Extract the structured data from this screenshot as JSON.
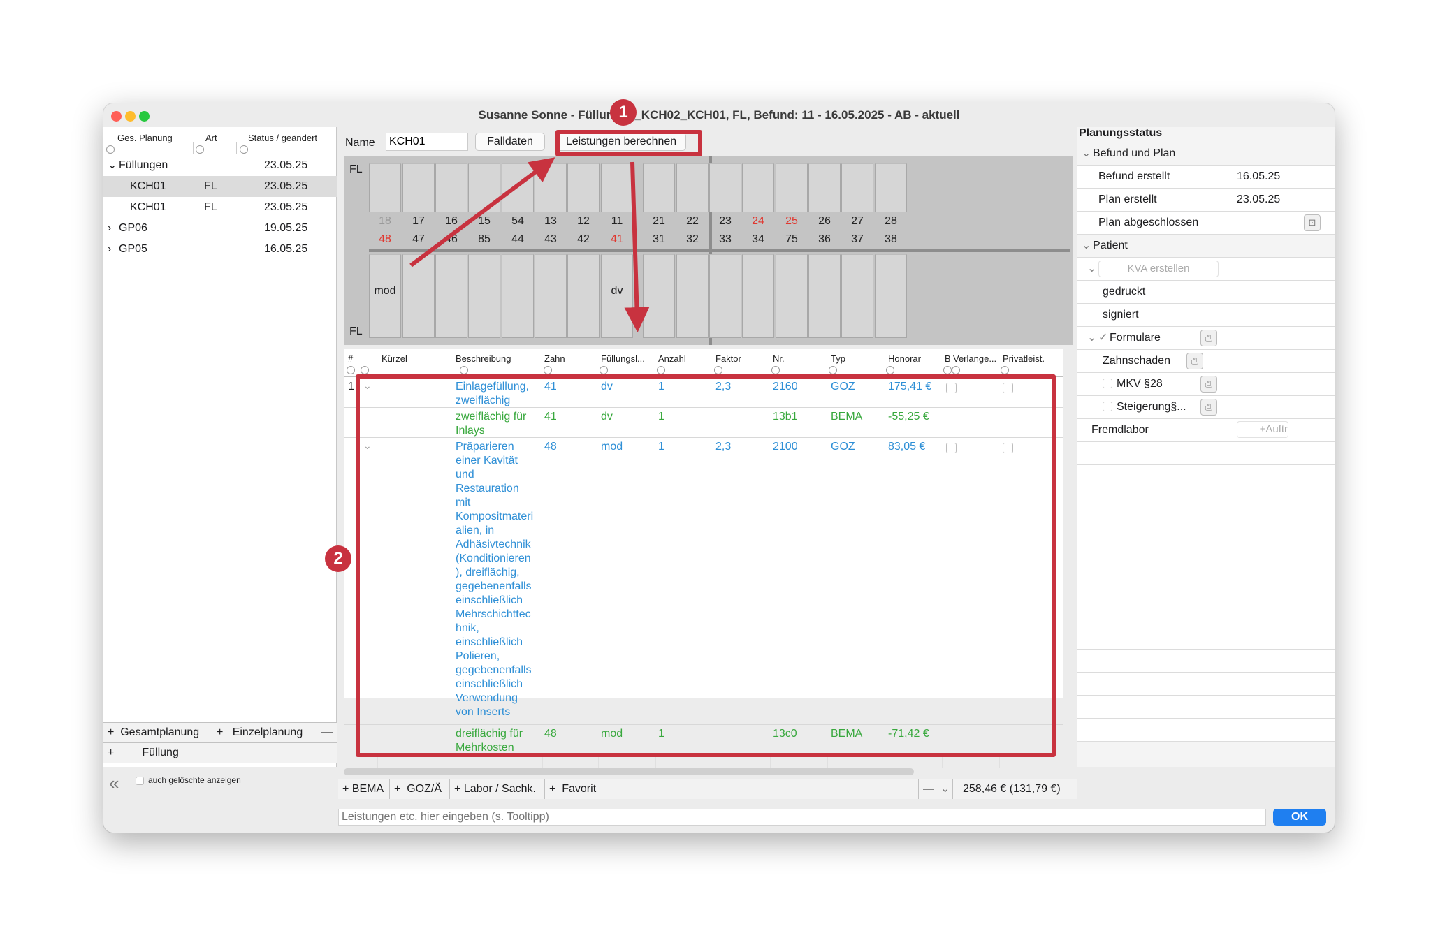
{
  "window": {
    "title": "Susanne Sonne  -  Füllungen_KCH02_KCH01, FL, Befund: 11 - 16.05.2025 - AB - aktuell"
  },
  "left_panel": {
    "headers": [
      "Ges. Planung",
      "Art",
      "Status / geändert"
    ],
    "rows": [
      {
        "name": "Füllungen",
        "art": "",
        "date": "23.05.25"
      },
      {
        "name": "KCH01",
        "art": "FL",
        "date": "23.05.25"
      },
      {
        "name": "KCH01",
        "art": "FL",
        "date": "23.05.25"
      },
      {
        "name": "GP06",
        "art": "",
        "date": "19.05.25"
      },
      {
        "name": "GP05",
        "art": "",
        "date": "16.05.25"
      }
    ],
    "btn_gesamt": "Gesamtplanung",
    "btn_einzel": "Einzelplanung",
    "btn_fuellung": "Füllung",
    "show_deleted": "auch gelöschte anzeigen"
  },
  "toolbar": {
    "name_label": "Name",
    "name_value": "KCH01",
    "falldaten": "Falldaten",
    "berechnen": "Leistungen berechnen"
  },
  "chart": {
    "label_top": "FL",
    "label_bottom": "FL",
    "upper_teeth": [
      "18",
      "17",
      "16",
      "15",
      "54",
      "13",
      "12",
      "11",
      "21",
      "22",
      "23",
      "24",
      "25",
      "26",
      "27",
      "28"
    ],
    "lower_teeth": [
      "48",
      "47",
      "46",
      "85",
      "44",
      "43",
      "42",
      "41",
      "31",
      "32",
      "33",
      "34",
      "75",
      "36",
      "37",
      "38"
    ],
    "mark_mod": "mod",
    "mark_dv": "dv",
    "colors": {
      "red": "#e0372f",
      "grey": "#9a9a9a"
    }
  },
  "table": {
    "headers": [
      "#",
      "Kürzel",
      "Beschreibung",
      "Zahn",
      "Füllungsl...",
      "Anzahl",
      "Faktor",
      "Nr.",
      "Typ",
      "Honorar",
      "B",
      "Verlange...",
      "Privatleist."
    ],
    "rows": [
      {
        "num": "1",
        "color": "#2e8fd6",
        "desc": "Einlagefüllung, zweiflächig",
        "zahn": "41",
        "fl": "dv",
        "anzahl": "1",
        "faktor": "2,3",
        "nr": "2160",
        "typ": "GOZ",
        "honorar": "175,41 €"
      },
      {
        "num": "",
        "color": "#38a83d",
        "desc": "zweiflächig für Inlays",
        "zahn": "41",
        "fl": "dv",
        "anzahl": "1",
        "faktor": "",
        "nr": "13b1",
        "typ": "BEMA",
        "honorar": "-55,25 €"
      },
      {
        "num": "",
        "color": "#2e8fd6",
        "desc": "Präparieren einer Kavität und Restauration mit Kompositmaterialien, in Adhäsivtechnik (Konditionieren), dreiflächig, gegebenenfalls einschließlich Mehrschichttechnik, einschließlich Polieren, gegebenenfalls einschließlich Verwendung von Inserts",
        "zahn": "48",
        "fl": "mod",
        "anzahl": "1",
        "faktor": "2,3",
        "nr": "2100",
        "typ": "GOZ",
        "honorar": "83,05 €"
      },
      {
        "num": "",
        "color": "#38a83d",
        "desc": "dreiflächig für Mehrkosten",
        "zahn": "48",
        "fl": "mod",
        "anzahl": "1",
        "faktor": "",
        "nr": "13c0",
        "typ": "BEMA",
        "honorar": "-71,42 €"
      }
    ],
    "row1_lines": [
      "Einlagefüllung,",
      "zweiflächig"
    ],
    "row2_lines": [
      "zweiflächig für",
      "Inlays"
    ],
    "row3_lines": [
      "Präparieren",
      "einer Kavität",
      "und",
      "Restauration",
      "mit",
      "Kompositmateri",
      "alien, in",
      "Adhäsivtechnik",
      "(Konditionieren",
      "), dreiflächig,",
      "gegebenenfalls",
      "einschließlich",
      "Mehrschichttec",
      "hnik,",
      "einschließlich",
      "Polieren,",
      "gegebenenfalls",
      "einschließlich",
      "Verwendung",
      "von Inserts"
    ],
    "row4_lines": [
      "dreiflächig für",
      "Mehrkosten"
    ]
  },
  "bottom_bar": {
    "bema": "BEMA",
    "goz": "GOZ/Ä",
    "labor": "Labor / Sachk.",
    "favorit": "Favorit",
    "total": "258,46 € (131,79 €)"
  },
  "input": {
    "placeholder": "Leistungen etc. hier eingeben (s. Tooltipp)",
    "ok": "OK"
  },
  "right_panel": {
    "title": "Planungsstatus",
    "befund_plan": "Befund und Plan",
    "befund_erstellt": "Befund erstellt",
    "befund_erstellt_date": "16.05.25",
    "plan_erstellt": "Plan erstellt",
    "plan_erstellt_date": "23.05.25",
    "plan_abgeschlossen": "Plan abgeschlossen",
    "patient": "Patient",
    "kva": "KVA erstellen",
    "gedruckt": "gedruckt",
    "signiert": "signiert",
    "formulare": "Formulare",
    "zahnschaden": "Zahnschaden",
    "mkv": "MKV §28",
    "steigerung": "Steigerung§...",
    "fremdlabor": "Fremdlabor",
    "auftr": "Auftr"
  },
  "annotations": {
    "badge1": "1",
    "badge2": "2"
  }
}
